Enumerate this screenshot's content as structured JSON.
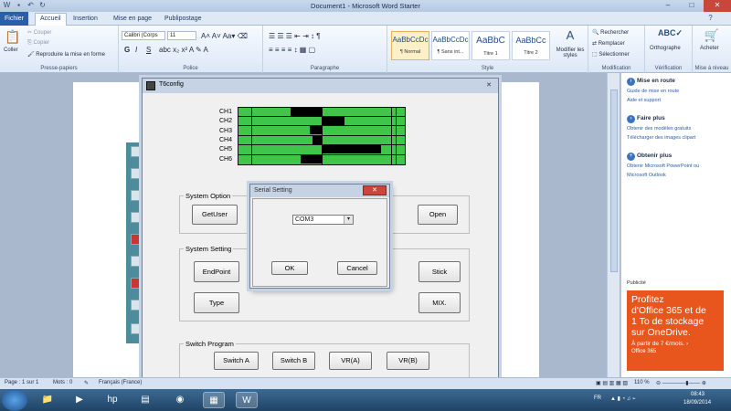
{
  "window": {
    "title": "Document1 - Microsoft Word Starter",
    "min_label": "–",
    "max_label": "□",
    "close_label": "✕"
  },
  "quick_access": {
    "save_icon": "save-icon",
    "undo_icon": "undo-icon",
    "redo_icon": "redo-icon"
  },
  "tabs": [
    "Fichier",
    "Accueil",
    "Insertion",
    "Mise en page",
    "Publipostage"
  ],
  "ribbon": {
    "clipboard": {
      "paste": "Coller",
      "cut": "Couper",
      "copy": "Copier",
      "format_painter": "Reproduire la mise en forme",
      "label": "Presse-papiers"
    },
    "font": {
      "name": "Calibri (Corps",
      "size": "11",
      "label": "Police",
      "bold": "G",
      "italic": "I",
      "underline": "S"
    },
    "paragraph": {
      "label": "Paragraphe"
    },
    "styles": {
      "label": "Style",
      "items": [
        {
          "sample": "AaBbCcDc",
          "name": "¶ Normal"
        },
        {
          "sample": "AaBbCcDc",
          "name": "¶ Sans int..."
        },
        {
          "sample": "AaBbC",
          "name": "Titre 1"
        },
        {
          "sample": "AaBbCc",
          "name": "Titre 2"
        }
      ],
      "modify": "Modifier les styles"
    },
    "editing": {
      "find": "Rechercher",
      "replace": "Remplacer",
      "select": "Sélectionner",
      "label": "Modification"
    },
    "proofing": {
      "spelling": "Orthographe",
      "label": "Vérification"
    },
    "buy": {
      "label_btn": "Acheter",
      "label": "Mise à niveau"
    }
  },
  "t6config": {
    "title": "T6config",
    "channels": [
      "CH1",
      "CH2",
      "CH3",
      "CH4",
      "CH5",
      "CH6"
    ],
    "system_option": {
      "legend": "System Option",
      "getuser": "GetUser",
      "open": "Open"
    },
    "system_setting": {
      "legend": "System Setting",
      "endpoint": "EndPoint",
      "stick": "Stick",
      "type": "Type",
      "mix": "MIX."
    },
    "switch_program": {
      "legend": "Switch Program",
      "a": "Switch A",
      "b": "Switch B",
      "vra": "VR(A)",
      "vrb": "VR(B)"
    }
  },
  "serial": {
    "title": "Serial Setting",
    "close": "✕",
    "port": "COM3",
    "ok": "OK",
    "cancel": "Cancel"
  },
  "right_pane": {
    "s1": {
      "title": "Mise en route",
      "links": [
        "Guide de mise en route",
        "Aide et support"
      ]
    },
    "s2": {
      "title": "Faire plus",
      "links": [
        "Obtenir des modèles gratuits",
        "Télécharger des images clipart"
      ]
    },
    "s3": {
      "title": "Obtenir plus",
      "links": [
        "Obtenir Microsoft PowerPoint ou",
        "Microsoft Outlook"
      ]
    },
    "pub": "Publicité",
    "ad": {
      "line1": "Profitez",
      "line2": "d'Office 365 et de",
      "line3": "1 To de stockage",
      "line4": "sur OneDrive.",
      "price": "À partir de 7 €/mois. ›",
      "brand": "Office 365"
    }
  },
  "status": {
    "page": "Page : 1 sur 1",
    "words": "Mots : 0",
    "lang": "Français (France)",
    "zoom": "110 %"
  },
  "taskbar": {
    "lang": "FR",
    "time": "08:43",
    "date": "18/09/2014"
  }
}
